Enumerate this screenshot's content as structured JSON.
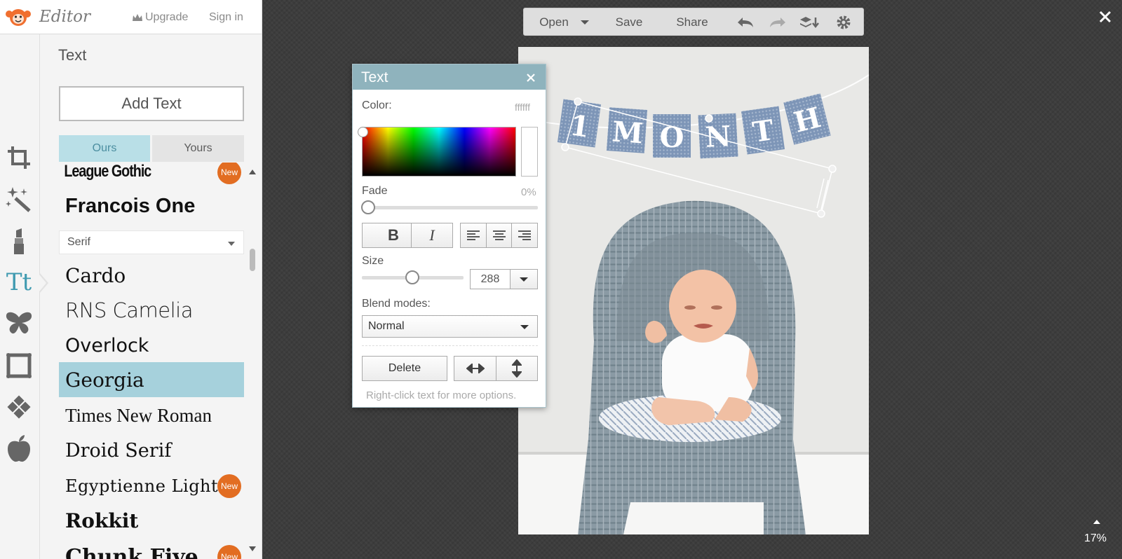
{
  "app": {
    "logo_text": "Editor",
    "upgrade_label": "Upgrade",
    "signin_label": "Sign in"
  },
  "sidebar": {
    "tools": [
      "crop-tool",
      "effects-tool",
      "touch-up-tool",
      "text-tool",
      "overlays-tool",
      "frames-tool",
      "textures-tool",
      "themes-tool"
    ],
    "active_tool": "text-tool",
    "text_tool_glyph": "Tt"
  },
  "text_panel": {
    "title": "Text",
    "add_text_label": "Add Text",
    "tabs": [
      {
        "label": "Ours",
        "active": true
      },
      {
        "label": "Yours",
        "active": false
      }
    ],
    "category": "Serif",
    "new_badge_label": "New",
    "fonts_top": [
      {
        "name": "League Gothic",
        "is_new": true
      },
      {
        "name": "Francois One",
        "is_new": false
      }
    ],
    "fonts": [
      {
        "name": "Cardo",
        "is_new": false,
        "selected": false
      },
      {
        "name": "RNS Camelia",
        "is_new": false,
        "selected": false
      },
      {
        "name": "Overlock",
        "is_new": false,
        "selected": false
      },
      {
        "name": "Georgia",
        "is_new": false,
        "selected": true
      },
      {
        "name": "Times New Roman",
        "is_new": false,
        "selected": false
      },
      {
        "name": "Droid Serif",
        "is_new": false,
        "selected": false
      },
      {
        "name": "Egyptienne Light",
        "is_new": true,
        "selected": false
      },
      {
        "name": "Rokkit",
        "is_new": false,
        "selected": false
      },
      {
        "name": "Chunk Five",
        "is_new": true,
        "selected": false
      }
    ]
  },
  "toolbar": {
    "open_label": "Open",
    "save_label": "Save",
    "share_label": "Share"
  },
  "canvas": {
    "banner_letters": [
      "1",
      "M",
      "O",
      "N",
      "T",
      "H"
    ],
    "zoom_label": "17%"
  },
  "text_dialog": {
    "title": "Text",
    "color_label": "Color:",
    "color_value": "ffffff",
    "fade_label": "Fade",
    "fade_value": "0%",
    "fade_fraction": 0,
    "bold_glyph": "B",
    "italic_glyph": "I",
    "size_label": "Size",
    "size_value": "288",
    "blend_label": "Blend modes:",
    "blend_value": "Normal",
    "delete_label": "Delete",
    "hint": "Right-click text for more options."
  },
  "colors": {
    "accent": "#8fb3bd",
    "tab_active": "#b9dfe7",
    "font_selected": "#a6d1dc",
    "new_badge": "#e26d22",
    "text_tool": "#3f9ab0",
    "pennant": "#7d95b7"
  }
}
